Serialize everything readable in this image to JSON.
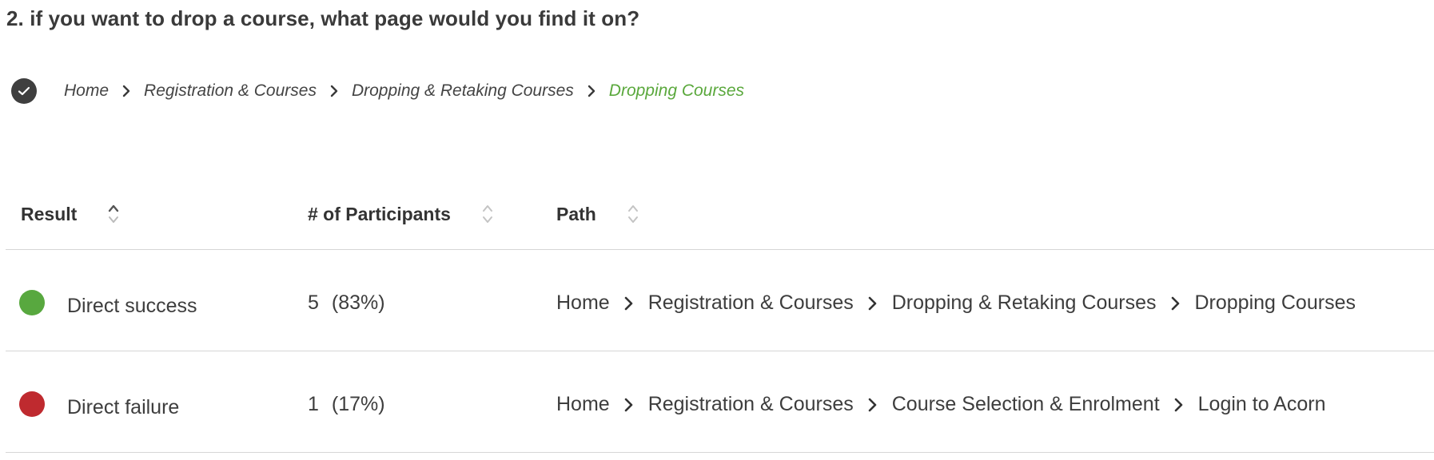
{
  "question": "2. if you want to drop a course, what page would you find it on?",
  "correct_path": {
    "check_icon": "check-circle-icon",
    "crumbs": [
      "Home",
      "Registration & Courses",
      "Dropping & Retaking Courses",
      "Dropping Courses"
    ],
    "destination_color": "#5aa83c"
  },
  "table": {
    "columns": [
      {
        "label": "Result",
        "sort_icon": "sort-icon"
      },
      {
        "label": "# of Participants",
        "sort_icon": "sort-icon"
      },
      {
        "label": "Path",
        "sort_icon": "sort-icon"
      }
    ],
    "rows": [
      {
        "status_color": "#58a83f",
        "result": "Direct success",
        "count": "5",
        "percent": "(83%)",
        "path": [
          "Home",
          "Registration & Courses",
          "Dropping & Retaking Courses",
          "Dropping Courses"
        ]
      },
      {
        "status_color": "#bf2a2f",
        "result": "Direct failure",
        "count": "1",
        "percent": "(17%)",
        "path": [
          "Home",
          "Registration & Courses",
          "Course Selection & Enrolment",
          "Login to Acorn"
        ]
      }
    ]
  }
}
